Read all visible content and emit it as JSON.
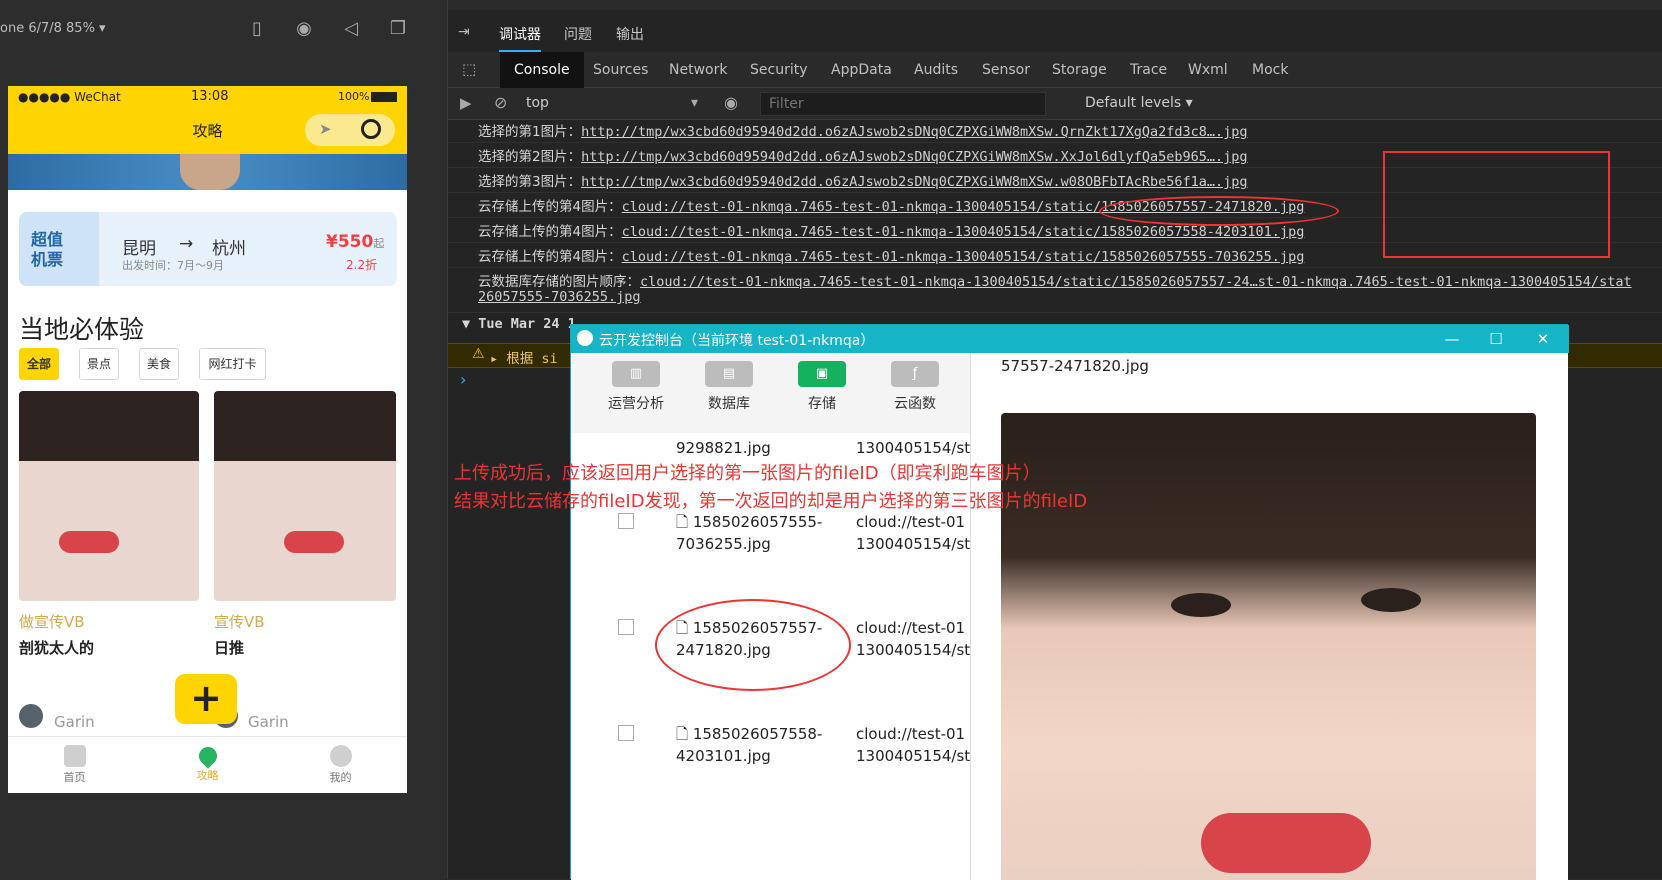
{
  "simulator": {
    "device_label": "one 6/7/8 85% ▾",
    "status_carrier": "●●●●● WeChat",
    "status_time": "13:08",
    "status_battery": "100%",
    "nav_title": "攻略",
    "ticket": {
      "tag_line1": "超值",
      "tag_line2": "机票",
      "from": "昆明",
      "arrow": "→",
      "to": "杭州",
      "time": "出发时间：7月～9月",
      "price": "¥550",
      "price_suffix": "起",
      "discount": "2.2折"
    },
    "section_title": "当地必体验",
    "chips": [
      "全部",
      "景点",
      "美食",
      "网红打卡"
    ],
    "cards": [
      {
        "tag": "做宣传VB",
        "desc": "剖犹太人的",
        "author": "Garin"
      },
      {
        "tag": "宣传VB",
        "desc": "日推",
        "author": "Garin"
      }
    ],
    "fab_label": "+",
    "tabs": [
      "首页",
      "攻略",
      "我的"
    ]
  },
  "devtools": {
    "top_tabs": [
      "调试器",
      "问题",
      "输出"
    ],
    "panel_tabs": [
      "Console",
      "Sources",
      "Network",
      "Security",
      "AppData",
      "Audits",
      "Sensor",
      "Storage",
      "Trace",
      "Wxml",
      "Mock"
    ],
    "context": "top",
    "filter_placeholder": "Filter",
    "levels": "Default levels ▾",
    "logs": [
      {
        "label": "选择的第1图片：",
        "value": "http://tmp/wx3cbd60d95940d2dd.o6zAJswob2sDNq0CZPXGiWW8mXSw.QrnZkt17XgQa2fd3c8….jpg"
      },
      {
        "label": "选择的第2图片：",
        "value": "http://tmp/wx3cbd60d95940d2dd.o6zAJswob2sDNq0CZPXGiWW8mXSw.XxJol6dlyfQa5eb965….jpg"
      },
      {
        "label": "选择的第3图片：",
        "value": "http://tmp/wx3cbd60d95940d2dd.o6zAJswob2sDNq0CZPXGiWW8mXSw.w08OBFbTAcRbe56f1a….jpg"
      },
      {
        "label": "云存储上传的第4图片：",
        "value": "cloud://test-01-nkmqa.7465-test-01-nkmqa-1300405154/static/1585026057557-2471820.jpg"
      },
      {
        "label": "云存储上传的第4图片：",
        "value": "cloud://test-01-nkmqa.7465-test-01-nkmqa-1300405154/static/1585026057558-4203101.jpg"
      },
      {
        "label": "云存储上传的第4图片：",
        "value": "cloud://test-01-nkmqa.7465-test-01-nkmqa-1300405154/static/1585026057555-7036255.jpg"
      }
    ],
    "db_log_label": "云数据库存储的图片顺序：",
    "db_log_value": "cloud://test-01-nkmqa.7465-test-01-nkmqa-1300405154/static/1585026057557-24…st-01-nkmqa.7465-test-01-nkmqa-1300405154/stat",
    "db_log_cont": "26057555-7036255.jpg",
    "group_header": "▼ Tue Mar 24 1",
    "warn_text": "▸ 根据 si",
    "prompt": "›"
  },
  "cloud_console": {
    "title": "云开发控制台（当前环境 test-01-nkmqa）",
    "tools": [
      "运营分析",
      "数据库",
      "存储",
      "云函数"
    ],
    "top_partial": "9298821.jpg",
    "top_partial_path": "1300405154/st",
    "files": [
      {
        "name1": "1585026057555-",
        "name2": "7036255.jpg",
        "path1": "cloud://test-01",
        "path2": "1300405154/st"
      },
      {
        "name1": "1585026057557-",
        "name2": "2471820.jpg",
        "path1": "cloud://test-01",
        "path2": "1300405154/st"
      },
      {
        "name1": "1585026057558-",
        "name2": "4203101.jpg",
        "path1": "cloud://test-01",
        "path2": "1300405154/st"
      }
    ],
    "preview_caption": "57557-2471820.jpg"
  },
  "annotation": {
    "line1": "上传成功后，应该返回用户选择的第一张图片的fileID（即宾利跑车图片）",
    "line2": "结果对比云储存的fileID发现，第一次返回的却是用户选择的第三张图片的fileID"
  },
  "colors": {
    "accent_yellow": "#ffd400",
    "annotation_red": "#ee3333",
    "cloud_title": "#15b4c6",
    "storage_green": "#16b15f"
  }
}
